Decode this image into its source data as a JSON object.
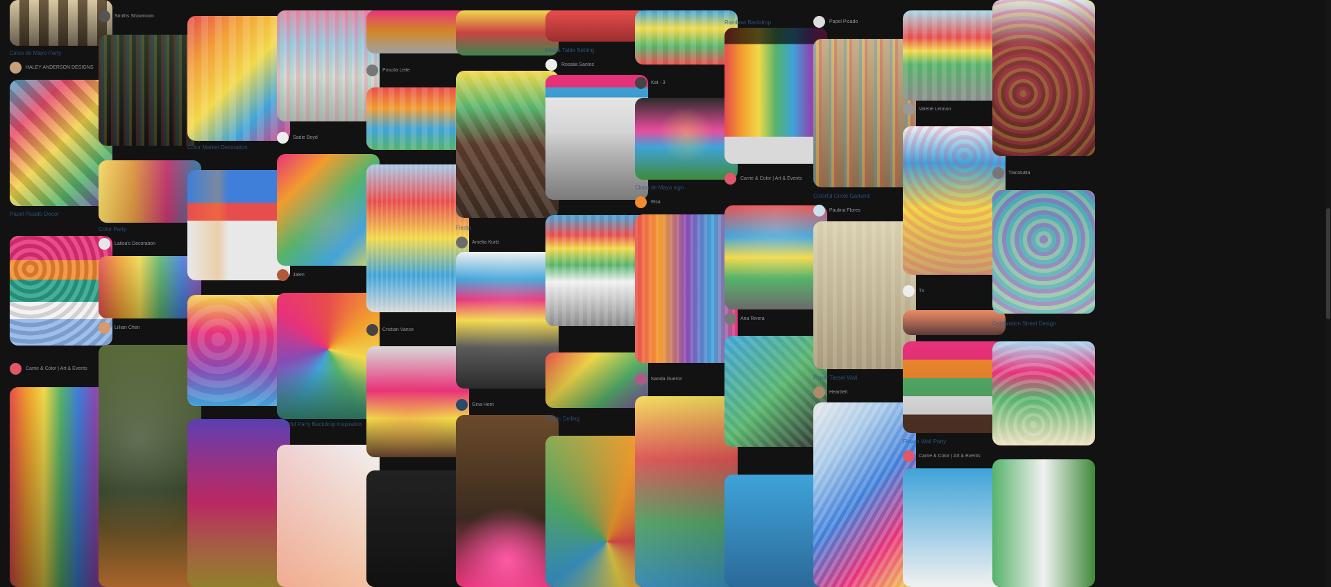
{
  "board": {
    "columns": [
      {
        "pins": [
          {
            "grad": "repeating-linear-gradient(90deg,#d9c8a3 0 14px,#6b5a3f 14px 28px)",
            "overlay": "linear-gradient(#fff0,#00000088)"
          },
          {
            "label": "Cinco de Mayo Party",
            "by": "HALEY ANDERSON DESIGNS",
            "av": "#c9a07c"
          },
          {
            "grad": "linear-gradient(135deg,#4aa8c9,#e84d6b,#f2d24a,#56b36b,#6f4ab3)",
            "overlay": "repeating-linear-gradient(45deg,#ffffff22 0 12px,#00000022 12px 24px)"
          },
          {
            "label": "Papel Picado Decor"
          },
          {
            "grad": "linear-gradient(180deg,#e8327a 0 22%,#f28a2e 22% 40%,#2aa38a 40% 60%,#f1f1f1 60% 76%,#8fb4e8 76%)",
            "overlay": "repeating-radial-gradient(circle at 20% 30%,#ffffff22 0 6px,#00000022 6px 12px)"
          },
          {
            "by": "Carrie & Color | Art & Events",
            "av": "#e0566b"
          },
          {
            "grad": "linear-gradient(90deg,#e84d4d,#f29c2e,#f2d94a,#56b36b,#3f7fd9,#8a4ab3,#e84d9d)",
            "overlay": "linear-gradient(#0000,#00000066)"
          }
        ]
      },
      {
        "pins": [
          {
            "by": "Smiths Showroom",
            "av": "#555555"
          },
          {
            "grad": "linear-gradient(180deg,#2b3a2a,#111)",
            "overlay": "repeating-linear-gradient(90deg,#e84d4d33 0 4px,#4aa8c933 4px 8px,#f2d24a33 8px 12px,#00000000 12px 18px)"
          },
          {
            "grad": "linear-gradient(90deg,#f2d24a,#f29c2e,#e8327a,#3fa3d9)",
            "overlay": "linear-gradient(120deg,#ffffff33,#00000055)"
          },
          {
            "label": "Color Party",
            "by": "Lalisa's Decoration",
            "av": "#e6e6e6"
          },
          {
            "grad": "linear-gradient(90deg,#e84d4d,#f29c2e,#f2d94a,#56b36b,#3f7fd9,#8a4ab3)",
            "overlay": "linear-gradient(#ffffff22,#00000044)"
          },
          {
            "by": "Lillian Chen",
            "av": "#d79a6a"
          },
          {
            "grad": "linear-gradient(180deg,#5a6b3a,#2b3a1f 60%,#a8642a)",
            "overlay": "radial-gradient(circle at 40% 40%,#ffffff33,#0000 60%)"
          }
        ]
      },
      {
        "pins": [
          {
            "grad": "linear-gradient(135deg,#e84d4d,#f2a13a,#f2d94a,#3fa3d9,#e8327a)",
            "overlay": "repeating-linear-gradient(90deg,#ffffff22 0 10px,#0000 10px 20px)"
          },
          {
            "label": "Color Market Decoration"
          },
          {
            "grad": "linear-gradient(180deg,#3f7fd9 0 30%,#e84d4d 30% 46%,#e8e8e8 46%)",
            "overlay": "linear-gradient(90deg,#0000,#f29c2e55 30%,#0000 40%)"
          },
          {
            "grad": "linear-gradient(180deg,#f2d24a,#e8327a,#8a4ab3,#3fa3d9)",
            "overlay": "repeating-radial-gradient(circle at 30% 40%,#ffffff22 0 10px,#0000 10px 20px)"
          },
          {
            "grad": "linear-gradient(180deg,#5a3fb3,#e8327a,#f2d24a)",
            "overlay": "linear-gradient(#0000,#00000066)"
          }
        ]
      },
      {
        "pins": [
          {
            "grad": "linear-gradient(180deg,#e88fb4,#a8c9e8 30%,#d9d9d9 60%,#b0b0b0)",
            "overlay": "repeating-linear-gradient(90deg,#e84d4d33 0 5px,#4ad98f33 5px 10px,#0000 10px 14px)"
          },
          {
            "by": "Sadie Boyd",
            "av": "#eeeeee"
          },
          {
            "grad": "linear-gradient(135deg,#e8327a,#f29c2e,#56b36b,#3fa3d9,#f2d94a)",
            "overlay": "radial-gradient(circle at 50% 60%,#ff9ad533,#0000 50%)"
          },
          {
            "by": "Jalen",
            "av": "#b05a3a"
          },
          {
            "grad": "conic-gradient(from 0deg at 50% 45%,#e84d4d,#f29c2e,#f2d94a,#56b36b,#3fa3d9,#8a4ab3,#e8327a,#e84d4d)",
            "overlay": "linear-gradient(#0000 60%,#2b6a5a)"
          },
          {
            "label": "Colorful Party Backdrop Inspiration"
          },
          {
            "grad": "linear-gradient(180deg,#f1f1f1,#f2c3a3)",
            "overlay": "linear-gradient(90deg,#e84d4d33,#0000)"
          }
        ]
      },
      {
        "pins": [
          {
            "grad": "linear-gradient(180deg,#e8327a,#f29c2e,#d9d9d9)",
            "overlay": "linear-gradient(#0000,#00000044)"
          },
          {
            "by": "Priscila Leite",
            "av": "#777777"
          },
          {
            "grad": "linear-gradient(180deg,#e84d4d,#f29c2e,#3fa3d9,#56b36b)",
            "overlay": "repeating-linear-gradient(90deg,#ffffff22 0 8px,#0000 8px 16px)"
          },
          {
            "grad": "linear-gradient(180deg,#a8c9e8,#e84d4d,#f2d94a,#3fa3d9,#d9d9d9)",
            "overlay": "repeating-linear-gradient(90deg,#ffffff22 0 3px,#0000 3px 7px)"
          },
          {
            "by": "Cristian Vance",
            "av": "#444444"
          },
          {
            "grad": "linear-gradient(180deg,#d9d9d9,#e8327a 40%,#f2d94a 65%,#5a3a2a)",
            "overlay": "radial-gradient(circle at 40% 60%,#e84d4d33,#0000 50%)"
          },
          {
            "grad": "linear-gradient(#222,#111)",
            "overlay": "none"
          }
        ]
      },
      {
        "pins": [
          {
            "grad": "linear-gradient(180deg,#f2d94a,#e84d4d,#56b36b)",
            "overlay": "linear-gradient(#0000,#00000044)"
          },
          {
            "grad": "linear-gradient(180deg,#f2d94a,#56b36b,#5a3a2a 50%,#3a2a1f)",
            "overlay": "repeating-linear-gradient(60deg,#ffffff22 0 10px,#0000 10px 20px)"
          },
          {
            "label": "Fiesta",
            "by": "Amelia Kurtz",
            "av": "#6b6b6b"
          },
          {
            "grad": "linear-gradient(180deg,#f1f1f1,#3fa3d9 20%,#e8327a 35%,#f2d94a 50%,#5a5a5a 70%,#2b2b2b)",
            "overlay": "radial-gradient(circle at 50% 30%,#ffffff22,#0000 60%)"
          },
          {
            "by": "Gina Hern",
            "av": "#2a4a6b"
          },
          {
            "grad": "linear-gradient(180deg,#6b4a2a,#3a2a1f 60%,#e8327a)",
            "overlay": "radial-gradient(circle at 50% 85%,#ff5aa5,#0000 35%)"
          }
        ]
      },
      {
        "pins": [
          {
            "grad": "linear-gradient(180deg,#e84d4d,#c43a3a)",
            "overlay": "linear-gradient(#0000,#00000033)"
          },
          {
            "label": "Fiesta Table Setting",
            "by": "Rosalia Santos",
            "av": "#eeeeee"
          },
          {
            "grad": "linear-gradient(180deg,#e8327a 0 10%,#3fa3d9 10% 18%,#f1f1f1 18% 45%,#a8a8a8)",
            "overlay": "linear-gradient(#0000,#00000044)"
          },
          {
            "grad": "linear-gradient(180deg,#3fa3d9,#e84d4d 18%,#f2d94a 30%,#56b36b 45%,#f1f1f1 60%,#8a8a8a)",
            "overlay": "repeating-linear-gradient(90deg,#ffffff22 0 6px,#0000 6px 12px)"
          },
          {
            "grad": "linear-gradient(135deg,#e84d4d,#f2d94a,#56b36b,#8a4ab3)",
            "overlay": "linear-gradient(#0000,#00000033)"
          },
          {
            "label": "Fabric Ceiling"
          },
          {
            "grad": "conic-gradient(from 90deg at 60% 70%,#e84d4d,#f2d94a,#3fa3d9,#56b36b,#f29c2e,#e84d4d)",
            "overlay": "linear-gradient(#0000,#00000033)"
          }
        ]
      },
      {
        "pins": [
          {
            "grad": "linear-gradient(180deg,#3fa3d9,#f2d94a,#56b36b,#e84d4d)",
            "overlay": "repeating-linear-gradient(90deg,#ffffff22 0 8px,#0000 8px 16px)"
          },
          {
            "by": "Kat · 3",
            "av": "#444444"
          },
          {
            "grad": "linear-gradient(180deg,#2b2b2b,#e84d9d 40%,#3fa3d9 60%,#3f8a3a)",
            "overlay": "radial-gradient(circle at 50% 45%,#f2d94a66,#0000 40%)"
          },
          {
            "label": "Cinco de Mayo sign",
            "by": "Elsa",
            "av": "#f28a2e"
          },
          {
            "grad": "linear-gradient(90deg,#e84d4d,#f29c2e,#8a4ab3,#3fa3d9,#e8327a)",
            "overlay": "repeating-linear-gradient(90deg,#ffffff22 0 4px,#0000 4px 10px)"
          },
          {
            "by": "Nanda Guerra",
            "av": "#b05a8a"
          },
          {
            "grad": "linear-gradient(180deg,#f2d94a,#e84d4d,#56b36b,#3fa3d9)",
            "overlay": "linear-gradient(135deg,#ffffff22,#00000044)"
          }
        ]
      },
      {
        "pins": [
          {
            "label": "Rainbow Backdrop"
          },
          {
            "grad": "linear-gradient(90deg,#e84d4d,#f29c2e,#f2d94a,#56b36b,#3fa3d9,#8a4ab3,#e8327a)",
            "overlay": "linear-gradient(#000000aa 0 12%,#0000 12% 80%,#d9d9d9 80%)"
          },
          {
            "by": "Carrie & Color | Art & Events",
            "av": "#e0566b"
          },
          {
            "grad": "linear-gradient(180deg,#e84d4d,#3fa3d9 30%,#f2d94a 50%,#56b36b 70%,#6b6b6b)",
            "overlay": "radial-gradient(circle at 50% 20%,#ffffff33,#0000 60%)"
          },
          {
            "by": "Ana Rivera",
            "av": "#777777"
          },
          {
            "grad": "linear-gradient(135deg,#3fa3d9,#56b36b,#2b2b2b)",
            "overlay": "repeating-linear-gradient(45deg,#ffffff22 0 6px,#0000 6px 12px)"
          },
          {
            "grad": "linear-gradient(#3fa3d9,#2b6a9a)",
            "overlay": "none"
          }
        ]
      },
      {
        "pins": [
          {
            "by": "Papel Picado",
            "av": "#dddddd"
          },
          {
            "grad": "linear-gradient(180deg,#c9b08a,#8a6b4a)",
            "overlay": "repeating-linear-gradient(90deg,#3fa3d955 0 4px,#f2d94a55 4px 8px,#e84d4d55 8px 12px,#0000 12px 22px)"
          },
          {
            "label": "Colorful Circle Garland",
            "by": "Paulina Flores",
            "av": "#c9e0f0"
          },
          {
            "grad": "linear-gradient(180deg,#d9d0b0,#a89a7a)",
            "overlay": "repeating-linear-gradient(90deg,#ffffff22 0 6px,#0000 6px 14px)"
          },
          {
            "label": "Paper Tassel Wall",
            "by": "Heartfelt",
            "av": "#b08a6a"
          },
          {
            "grad": "linear-gradient(135deg,#e8e8e8,#a8c9e8,#3f7fd9,#e8327a,#f2d94a)",
            "overlay": "repeating-linear-gradient(120deg,#ffffff33 0 5px,#0000 5px 10px)"
          }
        ]
      },
      {
        "pins": [
          {
            "grad": "linear-gradient(180deg,#a8d9e8,#e84d4d 30%,#f2d94a 45%,#56b36b 60%,#8a8a8a)",
            "overlay": "repeating-linear-gradient(90deg,#ffffff22 0 7px,#0000 7px 14px)"
          },
          {
            "by": "Valerie Lennon",
            "av": "#999999"
          },
          {
            "grad": "linear-gradient(180deg,#f1f1f1,#3fa3d9 25%,#f2d94a 55%,#c9a06b)",
            "overlay": "repeating-radial-gradient(circle at 60% 20%,#e8327a33 0 6px,#0000 6px 12px)"
          },
          {
            "by": "Tx",
            "av": "#eeeeee"
          },
          {
            "grad": "linear-gradient(180deg,#e87a4d,#5a3a3a)",
            "overlay": "linear-gradient(#ffffff22,#0000)"
          },
          {
            "grad": "linear-gradient(180deg,#e8327a 0 20%,#f28a2e 20% 40%,#56b36b 40% 60%,#f1f1f1 60% 80%,#5a3a2a 80%)",
            "overlay": "linear-gradient(#0000,#00000033)"
          },
          {
            "label": "Flower Wall Party",
            "by": "Carrie & Color | Art & Events",
            "av": "#e0566b"
          },
          {
            "grad": "linear-gradient(#3fa3d9,#f1f1f1)",
            "overlay": "none"
          }
        ]
      },
      {
        "pins": [
          {
            "grad": "linear-gradient(180deg,#d9e8f0,#8a3a3a 30%,#5a2a1f)",
            "overlay": "repeating-radial-gradient(circle at 30% 60%,#f2d94a44 0 5px,#e8327a44 5px 10px,#0000 10px 16px)"
          },
          {
            "by": "Tlacolulita",
            "av": "#777777"
          },
          {
            "grad": "linear-gradient(180deg,#3fa3d9,#8ac9e8)",
            "overlay": "repeating-radial-gradient(circle at 50% 40%,#e8327a55 0 6px,#f2d94a55 6px 12px,#56b36b55 12px 18px)"
          },
          {
            "label": "Celebration Street Design"
          },
          {
            "grad": "linear-gradient(180deg,#a8d9f0,#e8327a 30%,#56b36b 55%,#f1e0c0)",
            "overlay": "repeating-radial-gradient(circle at 40% 80%,#ffffff33 0 5px,#0000 5px 12px)"
          },
          {
            "grad": "linear-gradient(90deg,#56b36b,#f1f1f1,#3f8a3a)",
            "overlay": "none"
          }
        ]
      }
    ]
  }
}
